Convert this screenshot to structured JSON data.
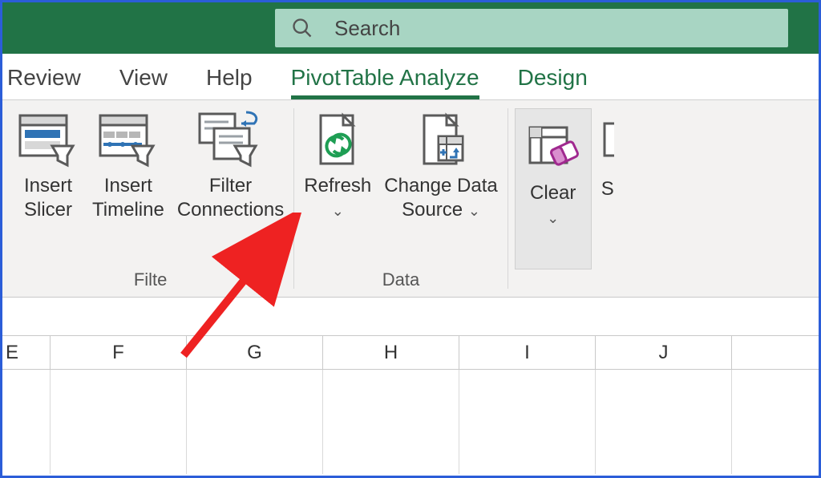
{
  "search": {
    "placeholder": "Search"
  },
  "tabs": {
    "review": "Review",
    "view": "View",
    "help": "Help",
    "pivot_analyze": "PivotTable Analyze",
    "design": "Design"
  },
  "ribbon": {
    "filter_group": {
      "label": "Filte",
      "insert_slicer": "Insert\nSlicer",
      "insert_timeline": "Insert\nTimeline",
      "filter_connections": "Filter\nConnections"
    },
    "data_group": {
      "label": "Data",
      "refresh": "Refresh",
      "change_data_source": "Change Data\nSource"
    },
    "actions_group": {
      "clear": "Clear",
      "select_partial": "S"
    }
  },
  "columns": [
    "E",
    "F",
    "G",
    "H",
    "I",
    "J"
  ]
}
